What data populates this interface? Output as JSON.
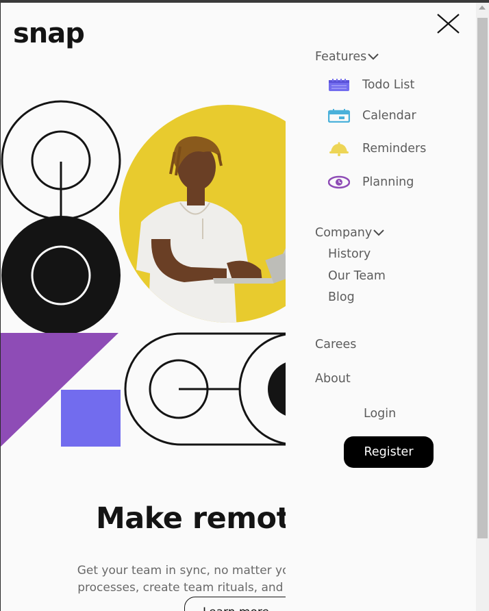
{
  "brand": {
    "logo": "snap"
  },
  "hero": {
    "headline": "Make remote",
    "subtext_line1": "Get your team in sync, no matter you",
    "subtext_line2": "processes, create team rituals, and w",
    "learn_more": "Learn more"
  },
  "menu": {
    "features": {
      "title": "Features",
      "items": [
        {
          "label": "Todo List",
          "icon": "todo-icon",
          "color": "#726cee"
        },
        {
          "label": "Calendar",
          "icon": "calendar-icon",
          "color": "#4bb1da"
        },
        {
          "label": "Reminders",
          "icon": "bell-icon",
          "color": "#edd556"
        },
        {
          "label": "Planning",
          "icon": "planning-icon",
          "color": "#8e4cb6"
        }
      ]
    },
    "company": {
      "title": "Company",
      "items": [
        {
          "label": "History"
        },
        {
          "label": "Our Team"
        },
        {
          "label": "Blog"
        }
      ]
    },
    "careers": "Carees",
    "about": "About",
    "login": "Login",
    "register": "Register"
  },
  "colors": {
    "background": "#fafafa",
    "text": "#141414",
    "muted_text": "#696969",
    "hero_yellow": "#e8cb2e",
    "hero_purple": "#8e4cb6",
    "hero_blue": "#726cee"
  }
}
